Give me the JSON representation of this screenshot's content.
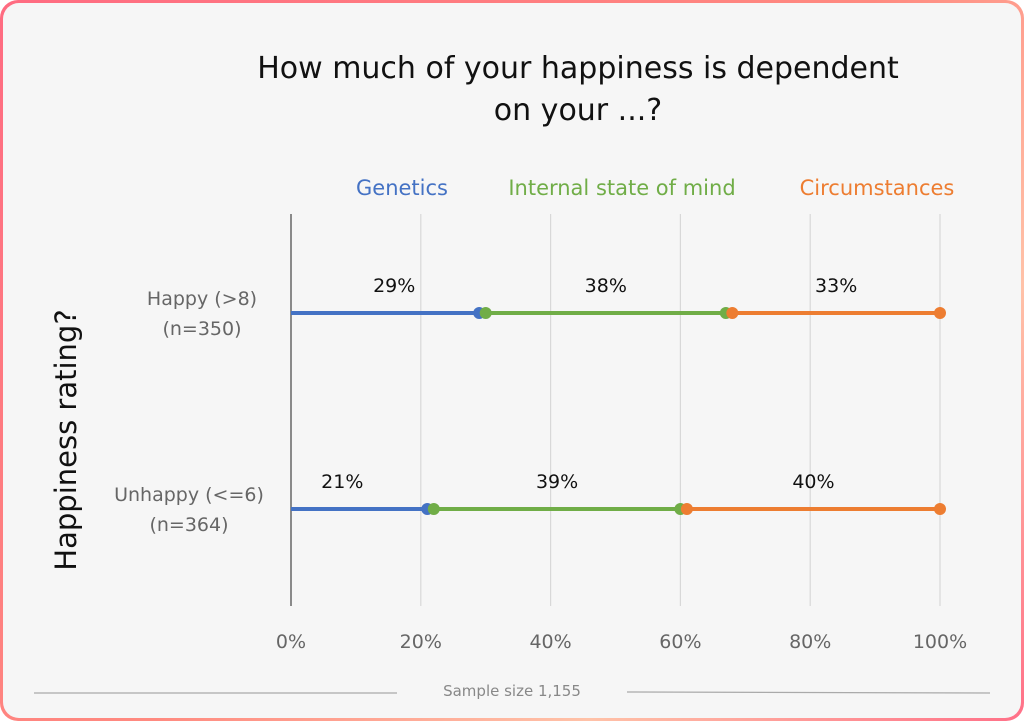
{
  "chart_data": {
    "type": "bar",
    "subtype": "stacked-horizontal-dumbbell",
    "title": [
      "How much of your happiness is dependent",
      "on your ...?"
    ],
    "ylabel": "Happiness rating?",
    "xlabel": "",
    "xlim": [
      0,
      100
    ],
    "xticks": [
      "0%",
      "20%",
      "40%",
      "60%",
      "80%",
      "100%"
    ],
    "xtick_values": [
      0,
      20,
      40,
      60,
      80,
      100
    ],
    "grid": true,
    "legend_position": "top",
    "categories": [
      {
        "label_line1": "Happy (>8)",
        "label_line2": "(n=350)"
      },
      {
        "label_line1": "Unhappy (<=6)",
        "label_line2": "(n=364)"
      }
    ],
    "series": [
      {
        "name": "Genetics",
        "color": "#4472c4",
        "values": [
          29,
          21
        ],
        "labels": [
          "29%",
          "21%"
        ]
      },
      {
        "name": "Internal state of mind",
        "color": "#70ad47",
        "values": [
          38,
          39
        ],
        "labels": [
          "38%",
          "39%"
        ]
      },
      {
        "name": "Circumstances",
        "color": "#ed7d31",
        "values": [
          33,
          40
        ],
        "labels": [
          "33%",
          "40%"
        ]
      }
    ],
    "footer": "Sample size 1,155"
  }
}
